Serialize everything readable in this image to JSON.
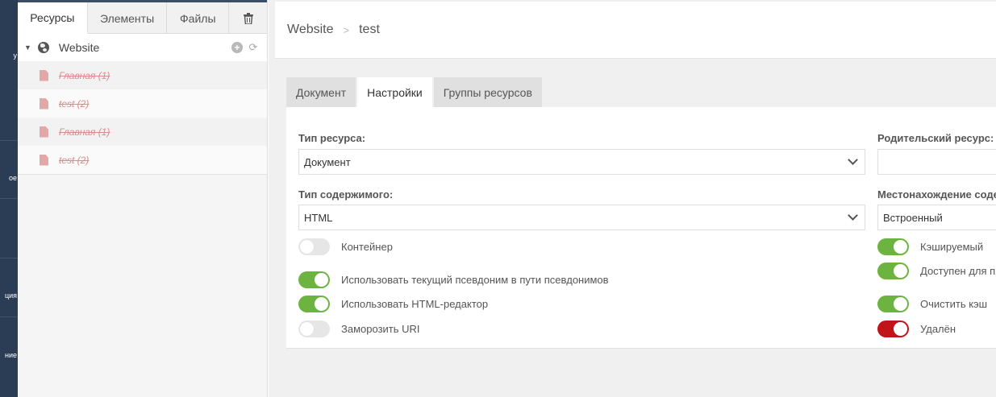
{
  "nav": {
    "items": [
      "у",
      "ое",
      "ция",
      "ние"
    ]
  },
  "tree": {
    "tabs": [
      "Ресурсы",
      "Элементы",
      "Файлы"
    ],
    "root_label": "Website",
    "nodes": [
      "Главная (1)",
      "test (2)",
      "Главная (1)",
      "test (2)"
    ]
  },
  "breadcrumb": {
    "parent": "Website",
    "current": "test"
  },
  "form_tabs": [
    "Документ",
    "Настройки",
    "Группы ресурсов"
  ],
  "form": {
    "resource_type_label": "Тип ресурса:",
    "resource_type_value": "Документ",
    "content_type_label": "Тип содержимого:",
    "content_type_value": "HTML",
    "parent_label": "Родительский ресурс:",
    "location_label": "Местонахождение соде",
    "location_value": "Встроенный"
  },
  "toggles_left": [
    {
      "label": "Контейнер",
      "state": "off"
    },
    {
      "label": "Использовать текущий псевдоним в пути псевдонимов",
      "state": "on"
    },
    {
      "label": "Использовать HTML-редактор",
      "state": "on"
    },
    {
      "label": "Заморозить URI",
      "state": "off"
    }
  ],
  "toggles_right": [
    {
      "label": "Кэшируемый",
      "state": "on"
    },
    {
      "label": "Доступен для п",
      "state": "on"
    },
    {
      "label": "Очистить кэш",
      "state": "on"
    },
    {
      "label": "Удалён",
      "state": "on",
      "color": "#c0131a"
    }
  ],
  "colors": {
    "nav_bg": "#2b3d55",
    "toggle_on": "#6cb33f",
    "toggle_danger": "#c0131a",
    "deleted_text": "#d98c8c"
  }
}
